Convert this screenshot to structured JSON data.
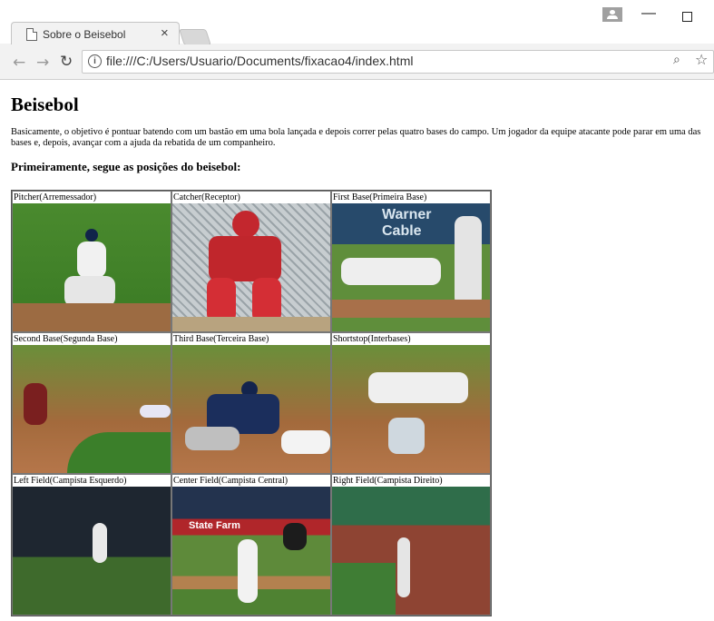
{
  "browser": {
    "tab_title": "Sobre o Beisebol",
    "tab_close": "×",
    "url": "file:///C:/Users/Usuario/Documents/fixacao4/index.html",
    "icons": [
      "page-icon",
      "back-arrow-icon",
      "forward-arrow-icon",
      "reload-icon",
      "info-icon",
      "zoom-icon",
      "star-icon",
      "profile-icon",
      "minimize-icon",
      "maximize-icon"
    ]
  },
  "page": {
    "heading": "Beisebol",
    "intro": "Basicamente, o objetivo é pontuar batendo com um bastão em uma bola lançada e depois correr pelas quatro bases do campo. Um jogador da equipe atacante pode parar em uma das bases e, depois, avançar com a ajuda da rebatida de um companheiro.",
    "subheading": "Primeiramente, segue as posições do beisebol:",
    "positions": [
      [
        "Pitcher(Arremessador)",
        "Catcher(Receptor)",
        "First Base(Primeira Base)"
      ],
      [
        "Second Base(Segunda Base)",
        "Third Base(Terceira Base)",
        "Shortstop(Interbases)"
      ],
      [
        "Left Field(Campista Esquerdo)",
        "Center Field(Campista Central)",
        "Right Field(Campista Direito)"
      ]
    ]
  }
}
